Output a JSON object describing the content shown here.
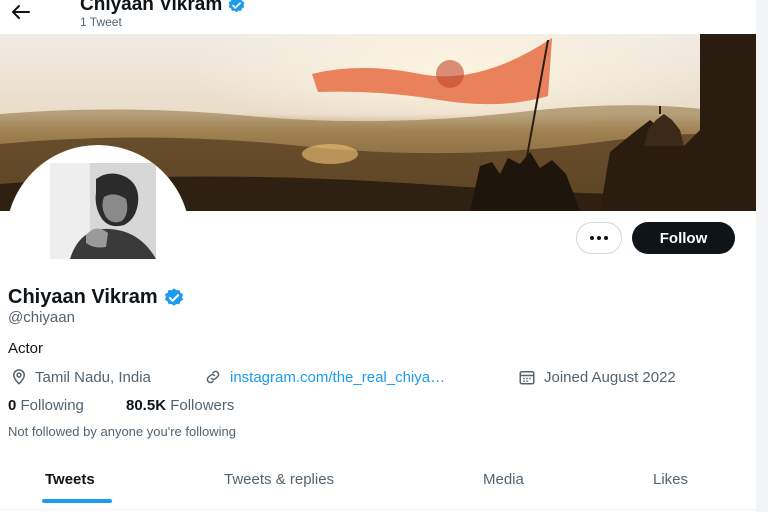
{
  "header": {
    "title": "Chiyaan Vikram",
    "subtitle": "1 Tweet",
    "back_icon": "arrow-left-icon"
  },
  "profile": {
    "name": "Chiyaan Vikram",
    "handle": "@chiyaan",
    "verified": true,
    "bio": "Actor",
    "location": "Tamil Nadu, India",
    "link_text": "instagram.com/the_real_chiya…",
    "joined": "Joined August 2022",
    "following_count": "0",
    "following_label": "Following",
    "followers_count": "80.5K",
    "followers_label": "Followers",
    "not_followed_text": "Not followed by anyone you're following"
  },
  "actions": {
    "follow_label": "Follow",
    "more_icon": "more-dots-icon"
  },
  "tabs": [
    {
      "label": "Tweets",
      "active": true
    },
    {
      "label": "Tweets & replies",
      "active": false
    },
    {
      "label": "Media",
      "active": false
    },
    {
      "label": "Likes",
      "active": false
    }
  ],
  "colors": {
    "accent": "#1d9bf0",
    "follow_button": "#0f1419",
    "secondary_text": "#536471"
  }
}
